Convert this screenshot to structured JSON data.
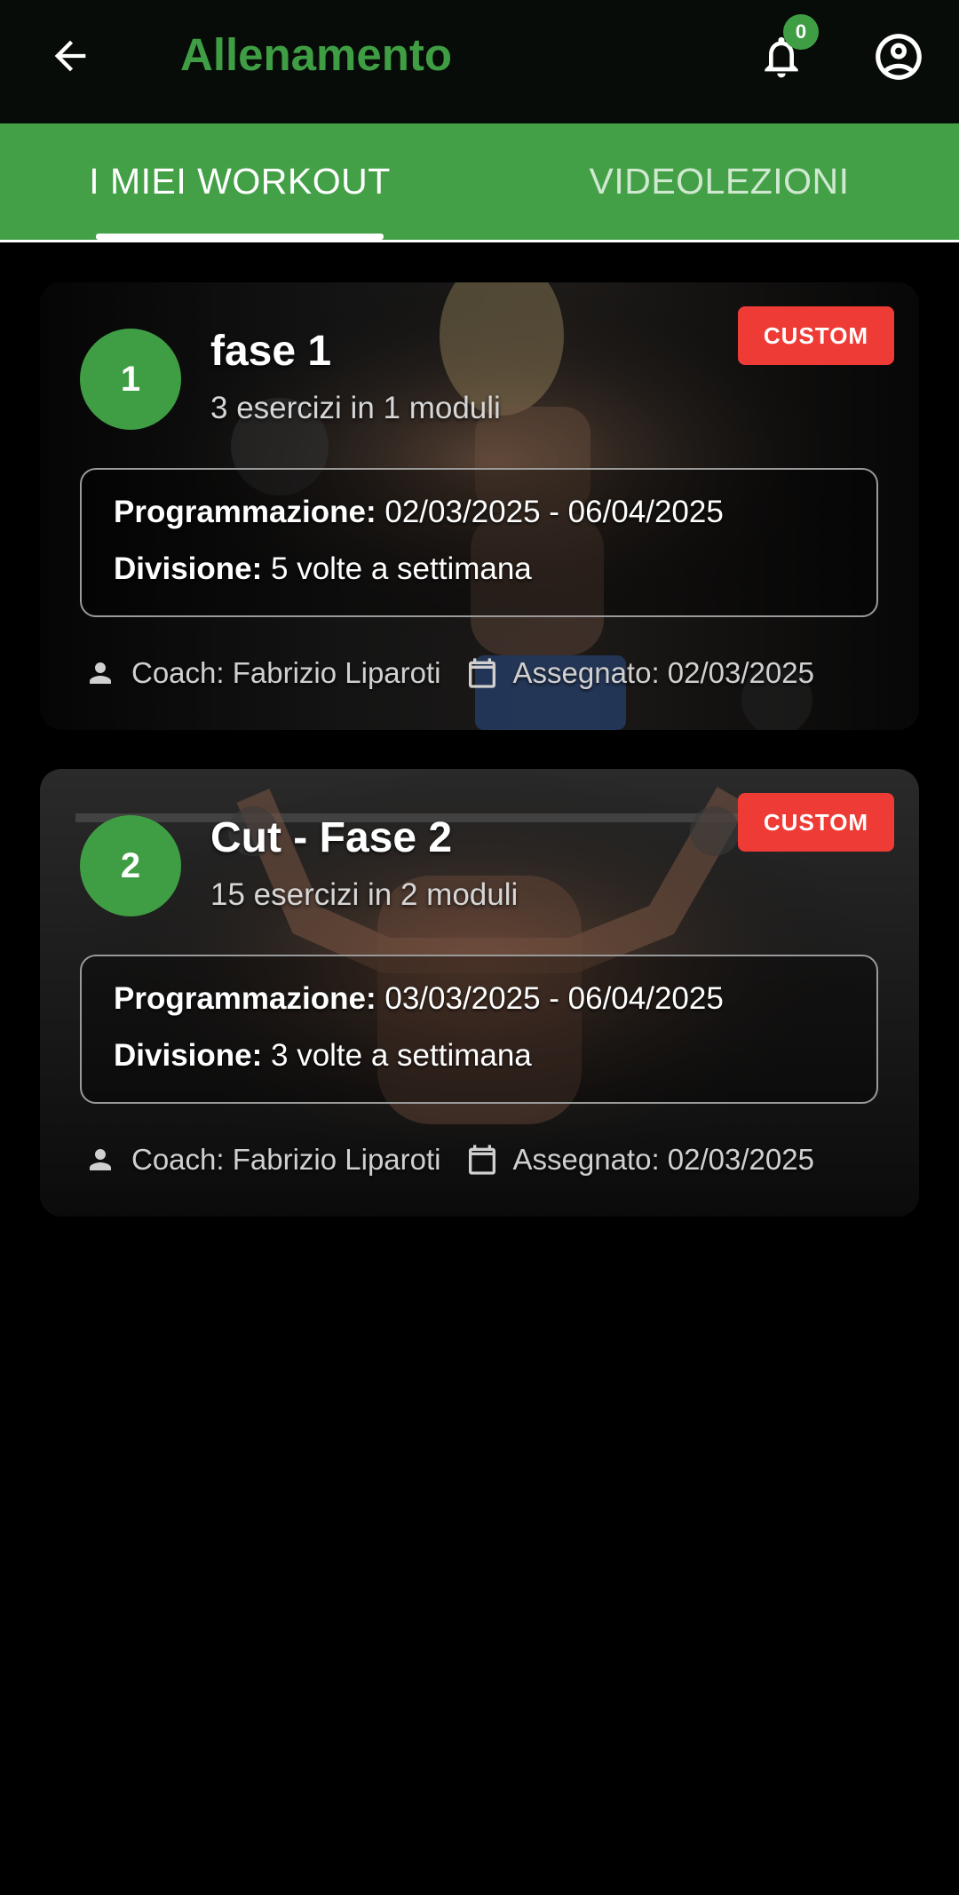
{
  "header": {
    "title": "Allenamento",
    "notifications_count": "0"
  },
  "tabs": [
    {
      "label": "I MIEI WORKOUT",
      "selected": true
    },
    {
      "label": "VIDEOLEZIONI",
      "selected": false
    }
  ],
  "workouts": [
    {
      "number": "1",
      "title": "fase 1",
      "subtitle": "3 esercizi in 1 moduli",
      "badge": "CUSTOM",
      "programmazione_label": "Programmazione:",
      "programmazione_value": "02/03/2025 - 06/04/2025",
      "divisione_label": "Divisione:",
      "divisione_value": "5 volte a settimana",
      "coach": "Coach: Fabrizio Liparoti",
      "assegnato": "Assegnato: 02/03/2025"
    },
    {
      "number": "2",
      "title": "Cut - Fase 2",
      "subtitle": "15 esercizi in 2 moduli",
      "badge": "CUSTOM",
      "programmazione_label": "Programmazione:",
      "programmazione_value": "03/03/2025 - 06/04/2025",
      "divisione_label": "Divisione:",
      "divisione_value": "3 volte a settimana",
      "coach": "Coach: Fabrizio Liparoti",
      "assegnato": "Assegnato: 02/03/2025"
    }
  ],
  "colors": {
    "accent_green": "#43a047",
    "title_green": "#3f9e44",
    "badge_red": "#ef3b36",
    "background": "#000000"
  }
}
